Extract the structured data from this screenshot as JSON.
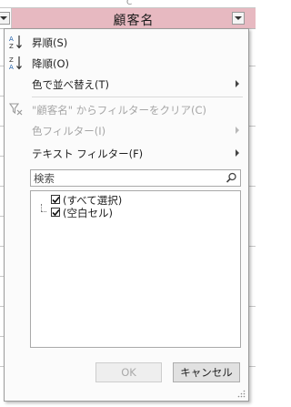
{
  "column_header": {
    "title": "顧客名",
    "top_marker": "C"
  },
  "menu": {
    "sort_asc": "昇順(S)",
    "sort_desc": "降順(O)",
    "sort_by_color": "色で並べ替え(T)",
    "clear_filter": "\"顧客名\" からフィルターをクリア(C)",
    "color_filter": "色フィルター(I)",
    "text_filter": "テキスト フィルター(F)"
  },
  "search": {
    "placeholder": "検索"
  },
  "filter_list": [
    {
      "label": "(すべて選択)",
      "checked": true
    },
    {
      "label": "(空白セル)",
      "checked": true
    }
  ],
  "buttons": {
    "ok": "OK",
    "cancel": "キャンセル"
  },
  "colors": {
    "header_fill": "#e7b9c1",
    "disabled_text": "#a6a6a6"
  }
}
